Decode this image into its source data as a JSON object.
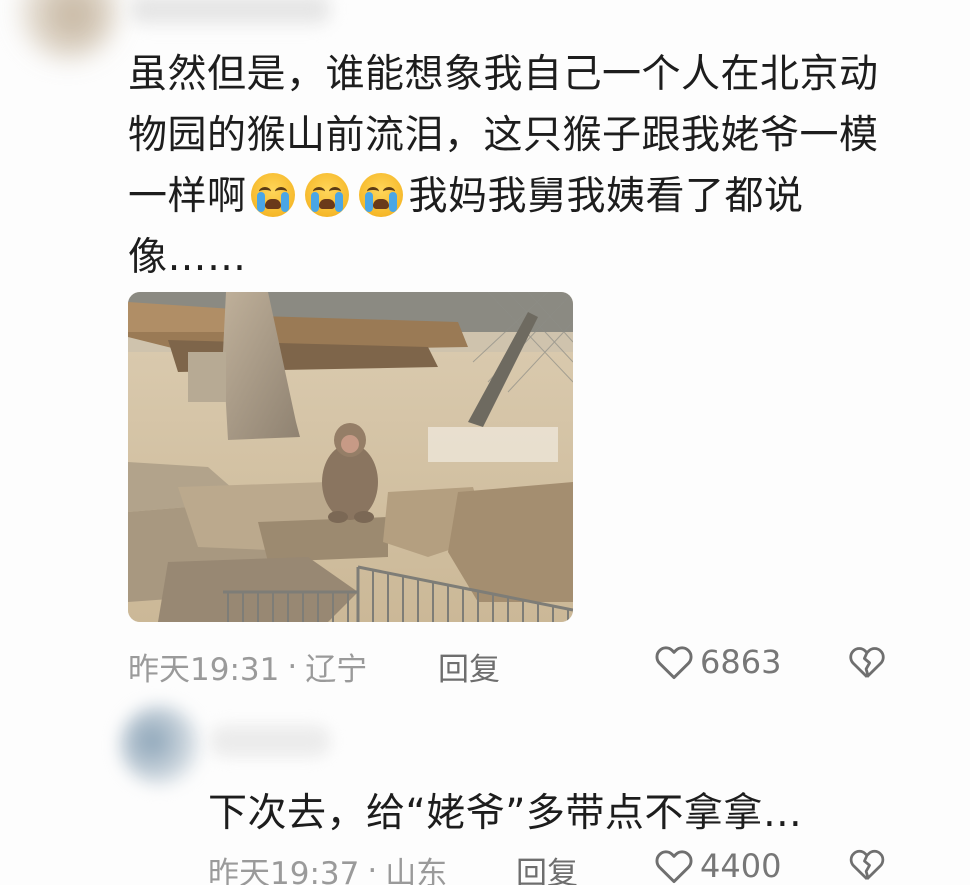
{
  "comment1": {
    "line1": "虽然但是，谁能想象我自己一个人在北京动",
    "line2": "物园的猴山前流泪，这只猴子跟我姥爷一模",
    "line3_before": "一样啊",
    "emojis": [
      "loudly-crying-face-icon",
      "loudly-crying-face-icon",
      "loudly-crying-face-icon"
    ],
    "line3_after": "我妈我舅我姨看了都说",
    "line4": "像……",
    "time": "昨天19:31",
    "separator": "·",
    "location": "辽宁",
    "reply_label": "回复",
    "likes": "6863"
  },
  "comment2": {
    "text": "下次去，给“姥爷”多带点不拿拿…",
    "time": "昨天19:37",
    "separator": "·",
    "location": "山东",
    "reply_label": "回复",
    "likes": "4400"
  },
  "colors": {
    "text": "#1d1d1d",
    "meta": "#9a9a9a",
    "icon": "#777777",
    "background": "#fdfdfd"
  }
}
